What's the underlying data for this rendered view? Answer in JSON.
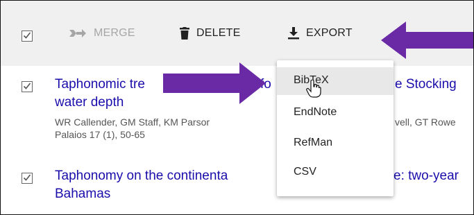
{
  "toolbar": {
    "merge_label": "MERGE",
    "delete_label": "DELETE",
    "export_label": "EXPORT",
    "disabled_color": "#a6a6a6"
  },
  "results": [
    {
      "title_line1_left": "Taphonomic tre",
      "title_line1_mid": "fo",
      "title_line1_right": "e Stocking",
      "title_line2": "water depth",
      "authors_left": "WR Callender, GM Staff, KM Parsor",
      "authors_right": "vell, GT Rowe",
      "source": "Palaios 17 (1), 50-65"
    },
    {
      "title_line1_left": "Taphonomy on the continenta",
      "title_line1_right": "e: two-year",
      "title_line2": "Bahamas"
    }
  ],
  "export_menu": {
    "items": [
      "BibTeX",
      "EndNote",
      "RefMan",
      "CSV"
    ],
    "hovered": "BibTeX"
  },
  "colors": {
    "link": "#1a0dab",
    "arrow": "#6a2aa6",
    "toolbar_bg": "#f0f0f0"
  },
  "icons": [
    "checkbox-checked-icon",
    "merge-icon",
    "trash-icon",
    "download-icon",
    "hand-cursor-icon",
    "purple-arrow-annotation"
  ]
}
